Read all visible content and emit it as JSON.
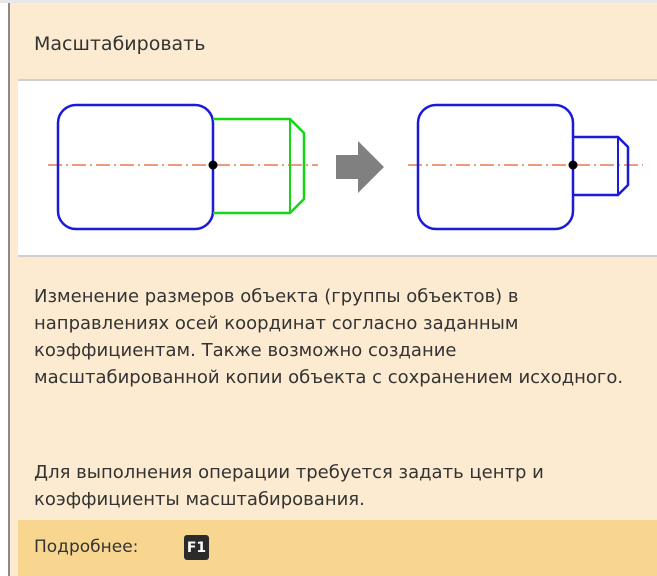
{
  "tooltip": {
    "title": "Масштабировать",
    "description": "Изменение размеров объекта (группы объектов) в направлениях осей координат согласно заданным коэффициентам. Также возможно создание масштабированной копии объекта с сохранением исходного.",
    "requirement": "Для выполнения операции требуется задать центр и коэффициенты масштабирования.",
    "more_label": "Подробнее:",
    "help_key": "F1"
  },
  "colors": {
    "background": "#fcebd0",
    "footer": "#f8d690",
    "outline_blue": "#1a1adb",
    "outline_green": "#16d416",
    "axis": "#e06030",
    "arrow": "#808080"
  },
  "icons": {
    "illustration": "scale-illustration",
    "arrow": "right-arrow-icon"
  }
}
